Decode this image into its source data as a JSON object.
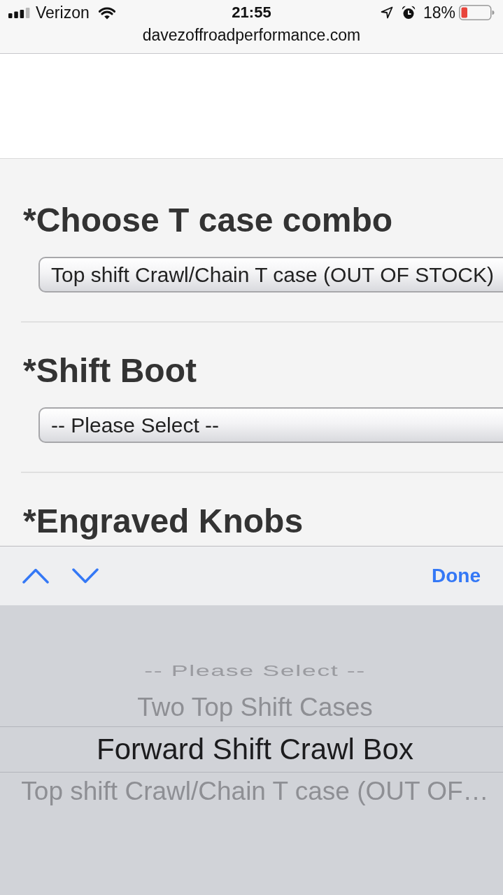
{
  "status_bar": {
    "carrier": "Verizon",
    "time": "21:55",
    "battery": "18%"
  },
  "address_bar": {
    "url": "davezoffroadperformance.com"
  },
  "form": {
    "fields": [
      {
        "label": "*Choose T case combo",
        "value": "Top shift Crawl/Chain T case (OUT OF STOCK)"
      },
      {
        "label": "*Shift Boot",
        "value": "-- Please Select --"
      },
      {
        "label": "*Engraved Knobs"
      }
    ]
  },
  "input_toolbar": {
    "done": "Done"
  },
  "picker": {
    "options": [
      {
        "label": "-- Please Select --",
        "selected": false
      },
      {
        "label": "Two Top Shift Cases",
        "selected": false
      },
      {
        "label": "Forward Shift Crawl Box",
        "selected": true
      },
      {
        "label": "Top shift Crawl/Chain T case (OUT OF…",
        "selected": false
      }
    ]
  }
}
